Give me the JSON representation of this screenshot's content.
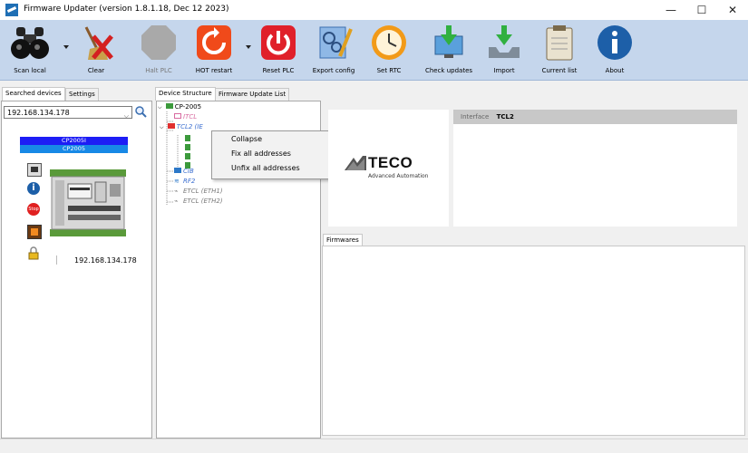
{
  "window": {
    "title": "Firmware Updater (version 1.8.1.18, Dec 12 2023)",
    "minimize": "—",
    "maximize": "☐",
    "close": "✕"
  },
  "toolbar": {
    "scan_local": "Scan local",
    "clear": "Clear",
    "halt_plc": "Halt PLC",
    "hot_restart": "HOT restart",
    "reset_plc": "Reset PLC",
    "export_config": "Export config",
    "set_rtc": "Set RTC",
    "check_updates": "Check updates",
    "import": "Import",
    "current_list": "Current list",
    "about": "About"
  },
  "left": {
    "tabs": [
      "Searched devices",
      "Settings"
    ],
    "ip_select": "192.168.134.178",
    "device_name": "CP2005I",
    "device_model": "CP2005",
    "device_ip": "192.168.134.178"
  },
  "tree": {
    "tabs": [
      "Device Structure",
      "Firmware Update List"
    ],
    "root": "CP-2005",
    "itcl": "ITCL",
    "tcl2": "TCL2 (IE",
    "cib": "CIB",
    "rf2": "RF2",
    "etcl1": "ETCL (ETH1)",
    "etcl2": "ETCL (ETH2)"
  },
  "context_menu": {
    "collapse": "Collapse",
    "fix_all": "Fix all addresses",
    "unfix_all": "Unfix all addresses"
  },
  "right": {
    "logo_main": "TECO",
    "logo_sub": "Advanced Automation",
    "interface_label": "Interface",
    "interface_value": "TCL2",
    "firmwares_tab": "Firmwares"
  }
}
